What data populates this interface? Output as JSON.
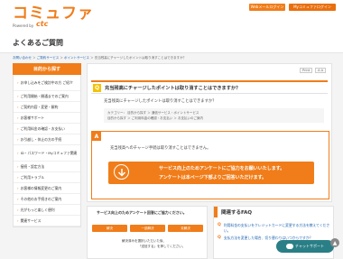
{
  "header": {
    "logo_main": "コミュファ",
    "logo_sub": "Powered by",
    "logo_brand": "ctc",
    "btn_web_login": "Webメールログイン",
    "btn_my_login": "Myコミュファログイン"
  },
  "page_title": "よくあるご質問",
  "breadcrumb": {
    "home": "お問い合わせ",
    "sep1": " ＞ ",
    "c1": "ご契約サービス",
    "sep2": " ＞ ",
    "c2": "ポイントサービス",
    "sep3": " ＞ ",
    "current": "充当残高にチャージしたポイントは取り消すことはできますか？"
  },
  "sidebar": {
    "head": "目的から探す",
    "items": [
      {
        "label": "お申し込みをご検討中の方  ご紹介"
      },
      {
        "label": "ご利用開始・開通までのご案内"
      },
      {
        "label": "ご契約内容・変更・解約"
      },
      {
        "label": "お客様サポート"
      },
      {
        "label": "ご利用料金の確認・お支払い"
      },
      {
        "label": "お引越し・休止の方の手続"
      },
      {
        "label": "ID・パスワード・Myコミュファ関連"
      },
      {
        "label": "接続・設定方法"
      },
      {
        "label": "ご利用トラブル"
      },
      {
        "label": "お客様の情報変更のご案内"
      },
      {
        "label": "その他のお手続きのご案内"
      },
      {
        "label": "光がもっと楽しく便利"
      },
      {
        "label": "関連サービス"
      }
    ]
  },
  "main": {
    "print": "Print",
    "size": "A A",
    "q_mark": "Q",
    "question": "充当残高にチャージしたポイントは取り消すことはできますか？",
    "question_body": "充当残高にチャージしたポイントは取り消すことはできますか？",
    "category_l1": "カテゴリー：  目的から探す ＞ 通信サービス・ポイントサービス",
    "category_l2": "目的から探す ＞ ご利用料金の確認・お支払い ＞ お支払いのご案内",
    "a_mark": "A",
    "answer": "充当残高へのチャージ手続は取り消すことはできません。",
    "banner_l1": "サービス向上のためアンケートにご協力をお願いいたします。",
    "banner_l2": "アンケートは本ページ下部よりご回答いただけます。"
  },
  "survey": {
    "question": "サービス向上のためアンケート回答にご協力ください。",
    "buttons": [
      "解決",
      "一部解決",
      "未解決"
    ],
    "note1": "解決済みを選択いただいた後、",
    "note2": "「送信する」を押してください。"
  },
  "related": {
    "title": "関連するFAQ",
    "items": [
      {
        "label": "利用料金の支払いをクレジットカードに変更する方法を教えてください。"
      },
      {
        "label": "支払方法を変更した場合、切り替わりはいつからですか？"
      }
    ]
  },
  "chat": "チャットサポート",
  "colors": {
    "accent": "#f07d1a",
    "link": "#1a61b0",
    "chat": "#2a7f86"
  }
}
